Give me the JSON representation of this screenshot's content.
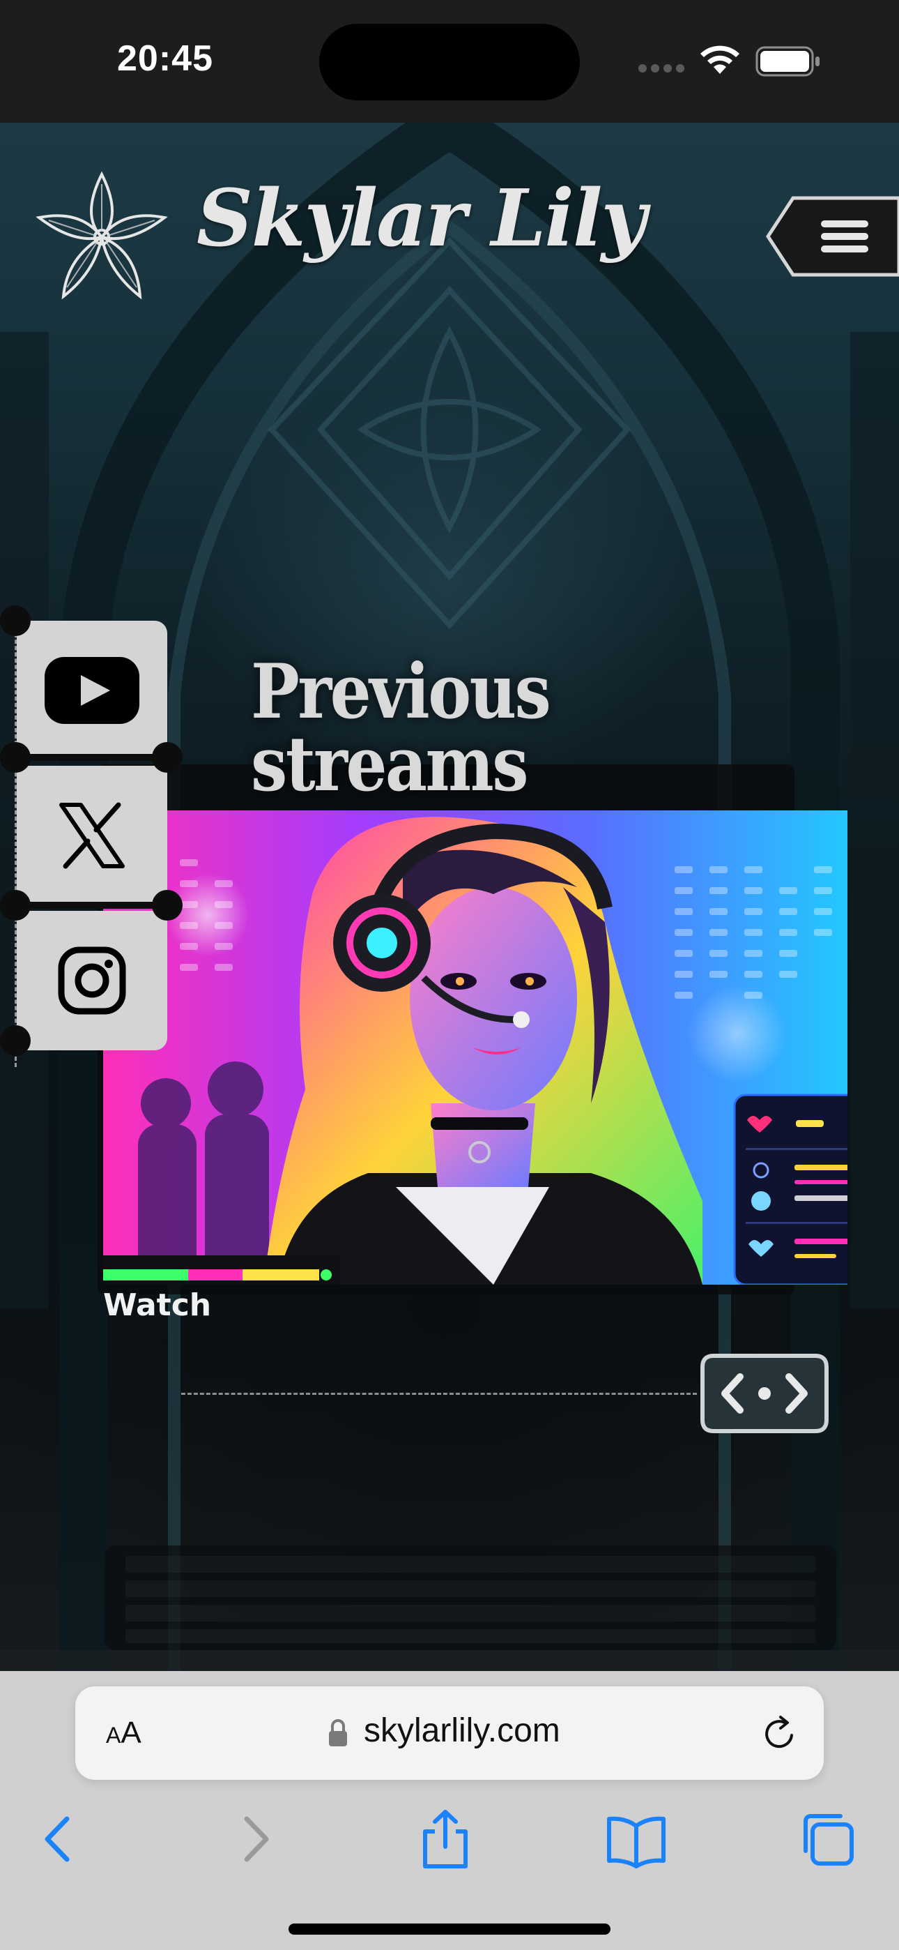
{
  "status_bar": {
    "time": "20:45"
  },
  "site": {
    "logo_text": "Skylar Lily",
    "section_title_line1": "Previous",
    "section_title_line2": "streams",
    "stream": {
      "watch_label": "Watch"
    }
  },
  "social": {
    "items": [
      {
        "label": "YouTube",
        "icon": "youtube-icon"
      },
      {
        "label": "X",
        "icon": "x-icon"
      },
      {
        "label": "Instagram",
        "icon": "instagram-icon"
      }
    ]
  },
  "browser": {
    "text_size_label_small": "A",
    "text_size_label_large": "A",
    "url": "skylarlily.com",
    "toolbar": [
      "back-icon",
      "forward-icon",
      "share-icon",
      "bookmarks-icon",
      "tabs-icon"
    ]
  },
  "colors": {
    "status_bar_bg": "#1d1d1d",
    "safari_bar_bg": "#d0d0d0",
    "ios_blue": "#1a82fb",
    "social_tab_bg": "#d4d4d4",
    "neon_pink": "#ff2fb8",
    "neon_cyan": "#23c8ff"
  }
}
